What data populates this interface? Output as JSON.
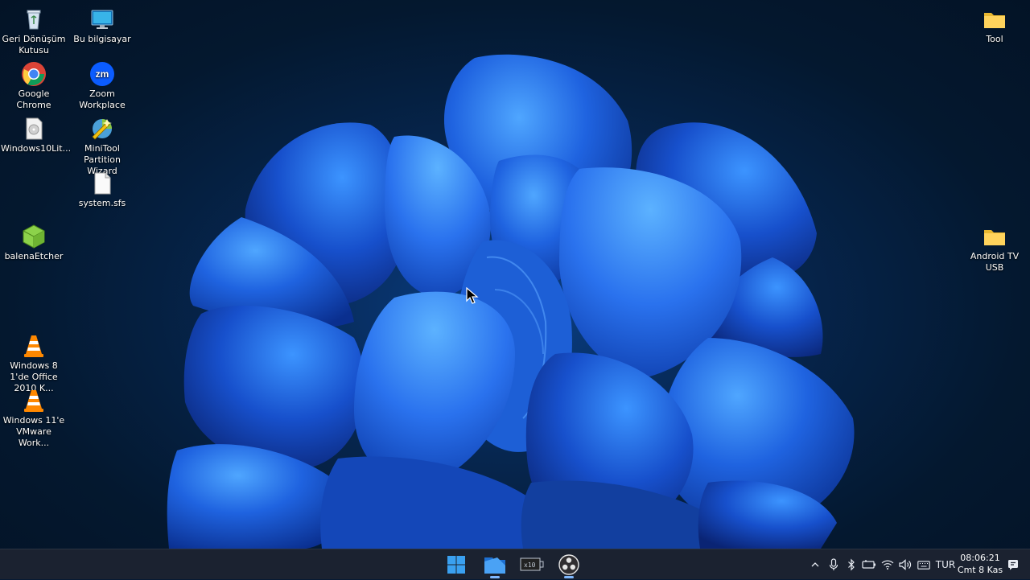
{
  "desktop_icons": [
    {
      "label": "Geri Dönüşüm Kutusu",
      "icon": "recycle-bin-icon"
    },
    {
      "label": "Bu bilgisayar",
      "icon": "this-pc-icon"
    },
    {
      "label": "Google Chrome",
      "icon": "chrome-icon"
    },
    {
      "label": "Zoom Workplace",
      "icon": "zoom-icon",
      "icon_text": "zm"
    },
    {
      "label": "Windows10Lit...",
      "icon": "disc-image-icon"
    },
    {
      "label": "MiniTool Partition Wizard",
      "icon": "minitool-icon"
    },
    {
      "label": "system.sfs",
      "icon": "file-icon"
    },
    {
      "label": "balenaEtcher",
      "icon": "balena-etcher-icon"
    },
    {
      "label": "Windows 8 1'de Office 2010 K...",
      "icon": "vlc-icon"
    },
    {
      "label": "Windows 11'e VMware Work...",
      "icon": "vlc-icon"
    },
    {
      "label": "Tool",
      "icon": "folder-icon"
    },
    {
      "label": "Android TV USB",
      "icon": "folder-icon"
    }
  ],
  "taskbar": {
    "apps": [
      {
        "name": "start",
        "icon": "windows-start-icon"
      },
      {
        "name": "file-explorer",
        "icon": "file-explorer-icon"
      },
      {
        "name": "terminal",
        "icon": "terminal-icon"
      },
      {
        "name": "obs",
        "icon": "obs-studio-icon"
      }
    ],
    "tray": {
      "language": "TUR",
      "time": "08:06:21",
      "date": "Cmt 8 Kas"
    }
  },
  "colors": {
    "taskbar_bg": "#1b2230",
    "accent": "#7fb8ff",
    "wallpaper": "#0a3f86"
  }
}
